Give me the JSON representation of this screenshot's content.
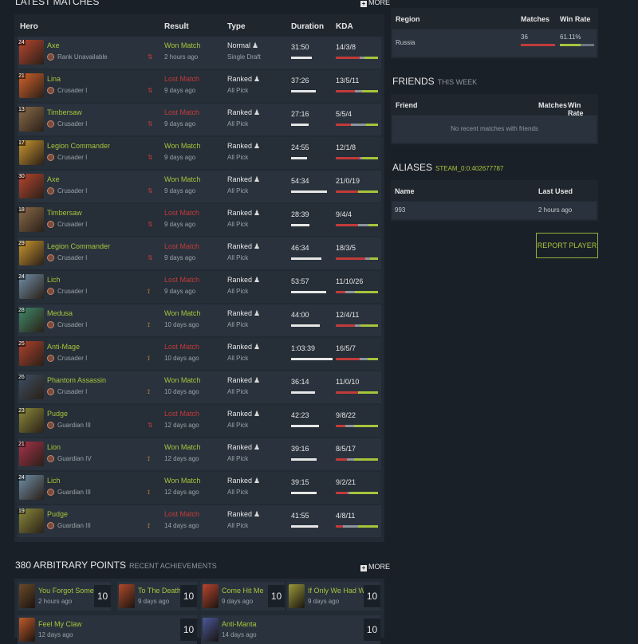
{
  "matches_section": {
    "title": "LATEST MATCHES",
    "more_label": "MORE",
    "headers": {
      "hero": "Hero",
      "result": "Result",
      "type": "Type",
      "duration": "Duration",
      "kda": "KDA"
    },
    "rows": [
      {
        "level": "24",
        "hero": "Axe",
        "rank": "Rank Unavailable",
        "result": "Won Match",
        "outcome": "won",
        "ago": "2 hours ago",
        "type": "Normal",
        "mode": "Single Draft",
        "duration": "31:50",
        "duration_seconds": 1910,
        "kda": "14/3/8",
        "color": "#b8452f",
        "side": "dire"
      },
      {
        "level": "21",
        "hero": "Lina",
        "rank": "Crusader I",
        "result": "Lost Match",
        "outcome": "lost",
        "ago": "9 days ago",
        "type": "Ranked",
        "mode": "All Pick",
        "duration": "37:26",
        "duration_seconds": 2246,
        "kda": "13/5/11",
        "color": "#d4612a",
        "side": "dire"
      },
      {
        "level": "13",
        "hero": "Timbersaw",
        "rank": "Crusader I",
        "result": "Lost Match",
        "outcome": "lost",
        "ago": "9 days ago",
        "type": "Ranked",
        "mode": "All Pick",
        "duration": "27:16",
        "duration_seconds": 1636,
        "kda": "5/5/4",
        "color": "#8a6a4a",
        "side": "dire"
      },
      {
        "level": "17",
        "hero": "Legion Commander",
        "rank": "Crusader I",
        "result": "Won Match",
        "outcome": "won",
        "ago": "9 days ago",
        "type": "Ranked",
        "mode": "All Pick",
        "duration": "24:55",
        "duration_seconds": 1495,
        "kda": "12/1/8",
        "color": "#c9962f",
        "side": "dire"
      },
      {
        "level": "30",
        "hero": "Axe",
        "rank": "Crusader I",
        "result": "Won Match",
        "outcome": "won",
        "ago": "9 days ago",
        "type": "Ranked",
        "mode": "All Pick",
        "duration": "54:34",
        "duration_seconds": 3274,
        "kda": "21/0/19",
        "color": "#b8452f",
        "side": "dire"
      },
      {
        "level": "18",
        "hero": "Timbersaw",
        "rank": "Crusader I",
        "result": "Lost Match",
        "outcome": "lost",
        "ago": "9 days ago",
        "type": "Ranked",
        "mode": "All Pick",
        "duration": "28:39",
        "duration_seconds": 1719,
        "kda": "9/4/4",
        "color": "#8a6a4a",
        "side": "dire"
      },
      {
        "level": "29",
        "hero": "Legion Commander",
        "rank": "Crusader I",
        "result": "Lost Match",
        "outcome": "lost",
        "ago": "9 days ago",
        "type": "Ranked",
        "mode": "All Pick",
        "duration": "46:34",
        "duration_seconds": 2794,
        "kda": "18/3/5",
        "color": "#c9962f",
        "side": "dire"
      },
      {
        "level": "24",
        "hero": "Lich",
        "rank": "Crusader I",
        "result": "Lost Match",
        "outcome": "lost",
        "ago": "9 days ago",
        "type": "Ranked",
        "mode": "All Pick",
        "duration": "53:57",
        "duration_seconds": 3237,
        "kda": "11/10/26",
        "color": "#6f8fa8",
        "side": "radiant"
      },
      {
        "level": "28",
        "hero": "Medusa",
        "rank": "Crusader I",
        "result": "Won Match",
        "outcome": "won",
        "ago": "10 days ago",
        "type": "Ranked",
        "mode": "All Pick",
        "duration": "44:00",
        "duration_seconds": 2640,
        "kda": "12/4/11",
        "color": "#3f8a6a",
        "side": "radiant"
      },
      {
        "level": "25",
        "hero": "Anti-Mage",
        "rank": "Crusader I",
        "result": "Lost Match",
        "outcome": "lost",
        "ago": "10 days ago",
        "type": "Ranked",
        "mode": "All Pick",
        "duration": "1:03:39",
        "duration_seconds": 3819,
        "kda": "16/5/7",
        "color": "#b0412c",
        "side": "radiant"
      },
      {
        "level": "26",
        "hero": "Phantom Assassin",
        "rank": "Crusader I",
        "result": "Won Match",
        "outcome": "won",
        "ago": "10 days ago",
        "type": "Ranked",
        "mode": "All Pick",
        "duration": "36:14",
        "duration_seconds": 2174,
        "kda": "11/0/10",
        "color": "#3d4e62",
        "side": "radiant"
      },
      {
        "level": "23",
        "hero": "Pudge",
        "rank": "Guardian III",
        "result": "Lost Match",
        "outcome": "lost",
        "ago": "12 days ago",
        "type": "Ranked",
        "mode": "All Pick",
        "duration": "42:23",
        "duration_seconds": 2543,
        "kda": "9/8/22",
        "color": "#8a8a3a",
        "side": "dire"
      },
      {
        "level": "21",
        "hero": "Lion",
        "rank": "Guardian IV",
        "result": "Won Match",
        "outcome": "won",
        "ago": "12 days ago",
        "type": "Ranked",
        "mode": "All Pick",
        "duration": "39:16",
        "duration_seconds": 2356,
        "kda": "8/5/17",
        "color": "#a8324a",
        "side": "radiant"
      },
      {
        "level": "24",
        "hero": "Lich",
        "rank": "Guardian III",
        "result": "Won Match",
        "outcome": "won",
        "ago": "12 days ago",
        "type": "Ranked",
        "mode": "All Pick",
        "duration": "39:15",
        "duration_seconds": 2355,
        "kda": "9/2/21",
        "color": "#6f8fa8",
        "side": "radiant"
      },
      {
        "level": "19",
        "hero": "Pudge",
        "rank": "Guardian III",
        "result": "Lost Match",
        "outcome": "lost",
        "ago": "14 days ago",
        "type": "Ranked",
        "mode": "All Pick",
        "duration": "41:55",
        "duration_seconds": 2515,
        "kda": "4/8/11",
        "color": "#8a8a3a",
        "side": "radiant"
      }
    ]
  },
  "region_table": {
    "headers": {
      "region": "Region",
      "matches": "Matches",
      "win_rate": "Win Rate"
    },
    "row": {
      "region": "Russia",
      "matches": "36",
      "win_rate": "61.11%",
      "win_fraction": 0.6111
    }
  },
  "friends": {
    "title": "FRIENDS",
    "subtitle": "THIS WEEK",
    "headers": {
      "friend": "Friend",
      "matches": "Matches",
      "win_rate": "Win Rate"
    },
    "empty": "No recent matches with friends"
  },
  "aliases": {
    "title": "ALIASES",
    "steam_id": "STEAM_0:0:402677787",
    "headers": {
      "name": "Name",
      "last_used": "Last Used"
    },
    "row": {
      "name": "993",
      "last_used": "2 hours ago"
    }
  },
  "report_button": "REPORT PLAYER",
  "achievements": {
    "title": "380 ARBITRARY POINTS",
    "subtitle": "RECENT ACHIEVEMENTS",
    "more_label": "MORE",
    "items": [
      {
        "name": "You Forgot Something",
        "ago": "2 hours ago",
        "points": "10",
        "color": "#6a4a2a"
      },
      {
        "name": "To The Death",
        "ago": "9 days ago",
        "points": "10",
        "color": "#b04a2a"
      },
      {
        "name": "Come Hit Me",
        "ago": "9 days ago",
        "points": "10",
        "color": "#b8452f"
      },
      {
        "name": "If Only We Had Wards",
        "ago": "9 days ago",
        "points": "10",
        "color": "#9a9a3a"
      },
      {
        "name": "Feel My Claw",
        "ago": "12 days ago",
        "points": "10",
        "color": "#c05a2a"
      },
      {
        "name": "Anti-Manta",
        "ago": "14 days ago",
        "points": "10",
        "color": "#4a5a9a"
      }
    ]
  },
  "colors": {
    "accent": "#a7c43c",
    "loss": "#c23a3a",
    "kill": "#c23a3a",
    "death": "#8e959c",
    "assist": "#a7c43c"
  }
}
